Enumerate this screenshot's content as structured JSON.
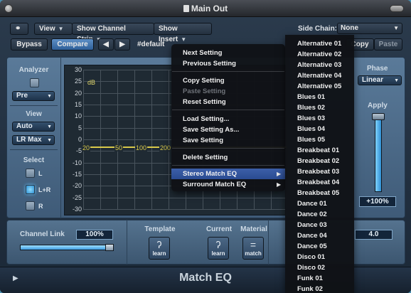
{
  "window": {
    "title": "Main Out"
  },
  "toolbar": {
    "view_label": "View",
    "show_channel_strip_label": "Show Channel Strip",
    "show_insert_label": "Show Insert",
    "side_chain_label": "Side Chain:",
    "side_chain_value": "None",
    "bypass_label": "Bypass",
    "compare_label": "Compare",
    "prev_label": "◀",
    "next_label": "▶",
    "setting_name": "#default",
    "copy_label": "Copy",
    "paste_label": "Paste"
  },
  "left_panel": {
    "analyzer_label": "Analyzer",
    "analyzer_mode": "Pre",
    "view_label": "View",
    "view_scale": "Auto",
    "view_channels": "LR Max",
    "select_label": "Select",
    "select_options": [
      "L",
      "L+R",
      "R"
    ],
    "selected_option": "L+R"
  },
  "graph": {
    "unit": "dB",
    "y_ticks": [
      "30",
      "25",
      "20",
      "15",
      "10",
      "5",
      "0",
      "-5",
      "-10",
      "-15",
      "-20",
      "-25",
      "-30"
    ],
    "x_ticks": [
      "20",
      "50",
      "100",
      "200"
    ]
  },
  "right_panel": {
    "phase_label": "Phase",
    "phase_value": "Linear",
    "apply_label": "Apply",
    "apply_value": "+100%"
  },
  "bottom": {
    "channel_link_label": "Channel Link",
    "channel_link_value": "100%",
    "template_label": "Template",
    "current_label": "Current",
    "material_label": "Material",
    "learn_label": "learn",
    "match_label": "match",
    "smoothing_value": "4.0",
    "plugin_name": "Match EQ"
  },
  "menu": {
    "items": [
      {
        "label": "Next Setting",
        "enabled": true
      },
      {
        "label": "Previous Setting",
        "enabled": true
      },
      {
        "label": "Copy Setting",
        "enabled": true
      },
      {
        "label": "Paste Setting",
        "enabled": false
      },
      {
        "label": "Reset Setting",
        "enabled": true
      },
      {
        "label": "Load Setting...",
        "enabled": true
      },
      {
        "label": "Save Setting As...",
        "enabled": true
      },
      {
        "label": "Save Setting",
        "enabled": true
      },
      {
        "label": "Delete Setting",
        "enabled": true
      },
      {
        "label": "Stereo Match EQ",
        "enabled": true,
        "highlighted": true
      },
      {
        "label": "Surround Match EQ",
        "enabled": true
      }
    ]
  },
  "submenu": {
    "items": [
      "Alternative 01",
      "Alternative 02",
      "Alternative 03",
      "Alternative 04",
      "Alternative 05",
      "Blues 01",
      "Blues 02",
      "Blues 03",
      "Blues 04",
      "Blues 05",
      "Breakbeat 01",
      "Breakbeat 02",
      "Breakbeat 03",
      "Breakbeat 04",
      "Breakbeat 05",
      "Dance 01",
      "Dance 02",
      "Dance 03",
      "Dance 04",
      "Dance 05",
      "Disco 01",
      "Disco 02",
      "Funk 01",
      "Funk 02"
    ]
  },
  "colors": {
    "accent": "#2e5f98",
    "curve": "#d9c94a",
    "menu_highlight": "#3c5fa9"
  }
}
